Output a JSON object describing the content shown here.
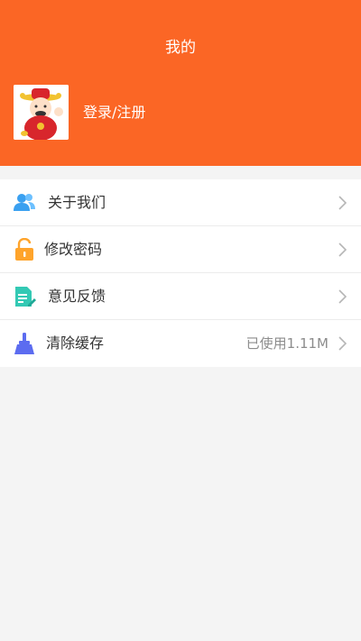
{
  "header": {
    "title": "我的",
    "login_text": "登录/注册",
    "bg_color": "#fb6625"
  },
  "menu": {
    "items": [
      {
        "label": "关于我们",
        "icon": "users-icon",
        "color": "#3aa0f0"
      },
      {
        "label": "修改密码",
        "icon": "unlock-icon",
        "color": "#ffa42b"
      },
      {
        "label": "意见反馈",
        "icon": "edit-document-icon",
        "color": "#33c9b4"
      },
      {
        "label": "清除缓存",
        "icon": "broom-icon",
        "color": "#5c6cf0",
        "extra": "已使用1.11M"
      }
    ]
  }
}
